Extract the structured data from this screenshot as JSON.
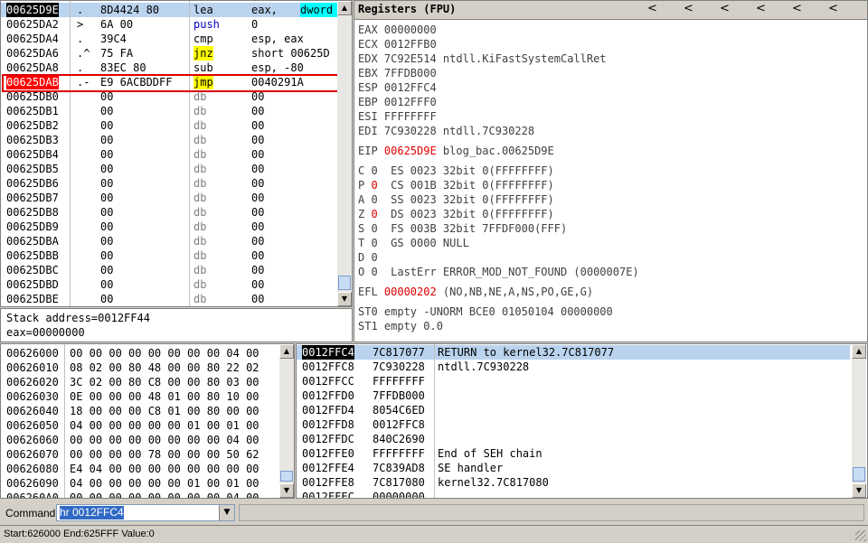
{
  "disasm": {
    "rows": [
      {
        "addr": "00625D9E",
        "mark": ".",
        "hex": "8D4424 80",
        "mn": "lea",
        "op1": "eax, ",
        "op2": "dword p",
        "sel": true
      },
      {
        "addr": "00625DA2",
        "mark": ">",
        "hex": "6A 00",
        "mn": "push",
        "op1": "0"
      },
      {
        "addr": "00625DA4",
        "mark": ".",
        "hex": "39C4",
        "mn": "cmp",
        "op1": "esp, eax"
      },
      {
        "addr": "00625DA6",
        "mark": ".^",
        "hex": "75 FA",
        "mn": "jnz",
        "op1": "short 00625D",
        "yellow": true
      },
      {
        "addr": "00625DA8",
        "mark": ".",
        "hex": "83EC 80",
        "mn": "sub",
        "op1": "esp, -80"
      },
      {
        "addr": "00625DAB",
        "mark": ".-",
        "hex": "E9 6ACBDDFF",
        "mn": "jmp",
        "op1": "0040291A",
        "yellow": true,
        "redaddr": true
      },
      {
        "addr": "00625DB0",
        "mark": "",
        "hex": "00",
        "mn": "db",
        "op1": "00"
      },
      {
        "addr": "00625DB1",
        "mark": "",
        "hex": "00",
        "mn": "db",
        "op1": "00"
      },
      {
        "addr": "00625DB2",
        "mark": "",
        "hex": "00",
        "mn": "db",
        "op1": "00"
      },
      {
        "addr": "00625DB3",
        "mark": "",
        "hex": "00",
        "mn": "db",
        "op1": "00"
      },
      {
        "addr": "00625DB4",
        "mark": "",
        "hex": "00",
        "mn": "db",
        "op1": "00"
      },
      {
        "addr": "00625DB5",
        "mark": "",
        "hex": "00",
        "mn": "db",
        "op1": "00"
      },
      {
        "addr": "00625DB6",
        "mark": "",
        "hex": "00",
        "mn": "db",
        "op1": "00"
      },
      {
        "addr": "00625DB7",
        "mark": "",
        "hex": "00",
        "mn": "db",
        "op1": "00"
      },
      {
        "addr": "00625DB8",
        "mark": "",
        "hex": "00",
        "mn": "db",
        "op1": "00"
      },
      {
        "addr": "00625DB9",
        "mark": "",
        "hex": "00",
        "mn": "db",
        "op1": "00"
      },
      {
        "addr": "00625DBA",
        "mark": "",
        "hex": "00",
        "mn": "db",
        "op1": "00"
      },
      {
        "addr": "00625DBB",
        "mark": "",
        "hex": "00",
        "mn": "db",
        "op1": "00"
      },
      {
        "addr": "00625DBC",
        "mark": "",
        "hex": "00",
        "mn": "db",
        "op1": "00"
      },
      {
        "addr": "00625DBD",
        "mark": "",
        "hex": "00",
        "mn": "db",
        "op1": "00"
      },
      {
        "addr": "00625DBE",
        "mark": "",
        "hex": "00",
        "mn": "db",
        "op1": "00"
      }
    ]
  },
  "info": {
    "line1": "Stack address=0012FF44",
    "line2": "eax=00000000"
  },
  "registers": {
    "title": "Registers (FPU)",
    "arrows": [
      "<",
      "<",
      "<",
      "<",
      "<",
      "<"
    ],
    "lines": [
      {
        "text": "EAX 00000000"
      },
      {
        "text": "ECX 0012FFB0"
      },
      {
        "text": "EDX 7C92E514 ntdll.KiFastSystemCallRet"
      },
      {
        "text": "EBX 7FFDB000"
      },
      {
        "text": "ESP 0012FFC4"
      },
      {
        "text": "EBP 0012FFF0"
      },
      {
        "text": "ESI FFFFFFFF"
      },
      {
        "text": "EDI 7C930228 ntdll.7C930228"
      },
      {
        "text": "",
        "gap": true
      },
      {
        "pre": "EIP ",
        "red": "00625D9E",
        "post": " blog_bac.00625D9E"
      },
      {
        "text": "",
        "gap": true
      },
      {
        "text": "C 0  ES 0023 32bit 0(FFFFFFFF)"
      },
      {
        "pre": "P ",
        "red": "0",
        "post": "  CS 001B 32bit 0(FFFFFFFF)"
      },
      {
        "text": "A 0  SS 0023 32bit 0(FFFFFFFF)"
      },
      {
        "pre": "Z ",
        "red": "0",
        "post": "  DS 0023 32bit 0(FFFFFFFF)"
      },
      {
        "text": "S 0  FS 003B 32bit 7FFDF000(FFF)"
      },
      {
        "text": "T 0  GS 0000 NULL"
      },
      {
        "text": "D 0"
      },
      {
        "text": "O 0  LastErr ERROR_MOD_NOT_FOUND (0000007E)"
      },
      {
        "text": "",
        "gap": true
      },
      {
        "pre": "EFL ",
        "red": "00000202",
        "post": " (NO,NB,NE,A,NS,PO,GE,G)"
      },
      {
        "text": "",
        "gap": true
      },
      {
        "text": "ST0 empty -UNORM BCE0 01050104 00000000"
      },
      {
        "text": "ST1 empty 0.0"
      }
    ]
  },
  "dump": {
    "rows": [
      {
        "addr": "00626000",
        "bytes": "00 00 00 00 00 00 00 00 04 00"
      },
      {
        "addr": "00626010",
        "bytes": "08 02 00 80 48 00 00 80 22 02"
      },
      {
        "addr": "00626020",
        "bytes": "3C 02 00 80 C8 00 00 80 03 00"
      },
      {
        "addr": "00626030",
        "bytes": "0E 00 00 00 48 01 00 80 10 00"
      },
      {
        "addr": "00626040",
        "bytes": "18 00 00 00 C8 01 00 80 00 00"
      },
      {
        "addr": "00626050",
        "bytes": "04 00 00 00 00 00 01 00 01 00"
      },
      {
        "addr": "00626060",
        "bytes": "00 00 00 00 00 00 00 00 04 00"
      },
      {
        "addr": "00626070",
        "bytes": "00 00 00 00 78 00 00 00 50 62"
      },
      {
        "addr": "00626080",
        "bytes": "E4 04 00 00 00 00 00 00 00 00"
      },
      {
        "addr": "00626090",
        "bytes": "04 00 00 00 00 00 01 00 01 00"
      },
      {
        "addr": "006260A0",
        "bytes": "00 00 00 00 00 00 00 00 04 00"
      }
    ]
  },
  "stack": {
    "rows": [
      {
        "addr": "0012FFC4",
        "val": "7C817077",
        "comment": "RETURN to kernel32.7C817077",
        "sel": true
      },
      {
        "addr": "0012FFC8",
        "val": "7C930228",
        "comment": "ntdll.7C930228"
      },
      {
        "addr": "0012FFCC",
        "val": "FFFFFFFF",
        "comment": ""
      },
      {
        "addr": "0012FFD0",
        "val": "7FFDB000",
        "comment": ""
      },
      {
        "addr": "0012FFD4",
        "val": "8054C6ED",
        "comment": ""
      },
      {
        "addr": "0012FFD8",
        "val": "0012FFC8",
        "comment": ""
      },
      {
        "addr": "0012FFDC",
        "val": "840C2690",
        "comment": ""
      },
      {
        "addr": "0012FFE0",
        "val": "FFFFFFFF",
        "comment": "End of SEH chain"
      },
      {
        "addr": "0012FFE4",
        "val": "7C839AD8",
        "comment": "SE handler"
      },
      {
        "addr": "0012FFE8",
        "val": "7C817080",
        "comment": "kernel32.7C817080"
      },
      {
        "addr": "0012FFEC",
        "val": "00000000",
        "comment": ""
      }
    ]
  },
  "command": {
    "label": "Command",
    "value": "hr 0012FFC4",
    "dropdown_icon": "▼"
  },
  "status": {
    "text": "Start:626000 End:625FFF Value:0"
  }
}
